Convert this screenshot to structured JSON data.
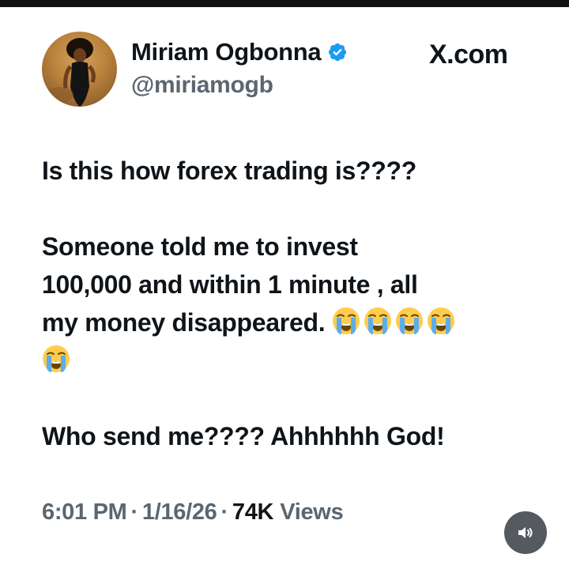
{
  "author": {
    "display_name": "Miriam Ogbonna",
    "handle": "@miriamogb",
    "verified": true
  },
  "brand": {
    "label": "X.com"
  },
  "tweet": {
    "line1": "Is this how forex trading is????",
    "line2": "Someone told me to invest",
    "line3": "100,000 and within 1 minute , all",
    "line4": "my money disappeared.",
    "line6": "Who send me???? Ahhhhhh God!",
    "emoji_count": 5,
    "emoji_name": "loudly-crying-face-emoji"
  },
  "meta": {
    "time": "6:01 PM",
    "date": "1/16/26",
    "views_count": "74K",
    "views_label": "Views",
    "separator": "·"
  },
  "colors": {
    "text": "#0f1419",
    "secondary": "#5b6670",
    "verified_badge": "#1d9bf0",
    "sound_button": "#555a60"
  },
  "icons": {
    "verified": "verified-badge-icon",
    "sound": "speaker-icon"
  }
}
